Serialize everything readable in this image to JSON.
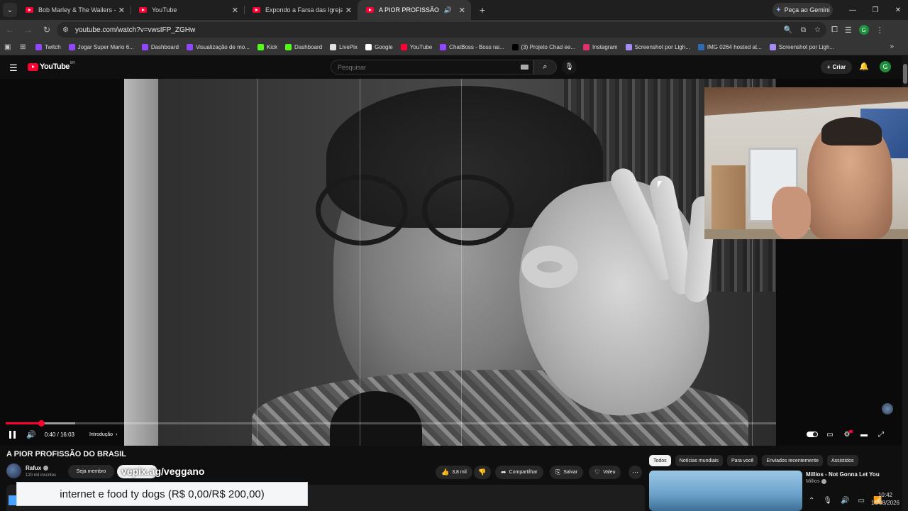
{
  "browser": {
    "tabs": [
      {
        "title": "Bob Marley & The Wailers - Exo",
        "active": false
      },
      {
        "title": "YouTube",
        "active": false
      },
      {
        "title": "Expondo a Farsa das Igrejas Ev",
        "active": false
      },
      {
        "title": "A PIOR PROFISSÃO DO BRA",
        "active": true
      }
    ],
    "gemini_label": "Peça ao Gemini",
    "url": "youtube.com/watch?v=vwsIFP_ZGHw",
    "profile_initial": "G",
    "bookmarks": [
      {
        "label": "Twitch",
        "color": "#9146ff"
      },
      {
        "label": "Jogar Super Mario 6...",
        "color": "#9146ff"
      },
      {
        "label": "Dashboard",
        "color": "#9146ff"
      },
      {
        "label": "Visualização de mo...",
        "color": "#9146ff"
      },
      {
        "label": "Kick",
        "color": "#53fc18"
      },
      {
        "label": "Dashboard",
        "color": "#53fc18"
      },
      {
        "label": "LivePix",
        "color": "#e0e0e0"
      },
      {
        "label": "Google",
        "color": "#ffffff"
      },
      {
        "label": "YouTube",
        "color": "#ff0033"
      },
      {
        "label": "ChatBoss - Boss rai...",
        "color": "#9146ff"
      },
      {
        "label": "(3) Projeto Chad ee...",
        "color": "#000000"
      },
      {
        "label": "Instagram",
        "color": "#e1306c"
      },
      {
        "label": "Screenshot por Ligh...",
        "color": "#a78bfa"
      },
      {
        "label": "IMG 0264 hosted at...",
        "color": "#2b6cb0"
      },
      {
        "label": "Screenshot por Ligh...",
        "color": "#a78bfa"
      }
    ]
  },
  "youtube": {
    "logo_text": "YouTube",
    "logo_country": "BR",
    "search_placeholder": "Pesquisar",
    "create_label": "Criar",
    "avatar_initial": "G"
  },
  "player": {
    "current_time": "0:40",
    "duration": "16:03",
    "time_display": "0:40 / 16:03",
    "progress_fraction": 0.0457,
    "chapter_label": "Introdução"
  },
  "video": {
    "title": "A PIOR PROFISSÃO DO BRASIL",
    "channel_name": "Rafux",
    "subscribers": "120 mil inscritos",
    "member_label": "Seja membro",
    "overlay_text": "vepix.ag/veggano",
    "likes": "3,8 mil",
    "share_label": "Compartilhar",
    "save_label": "Salvar",
    "thanks_label": "Valeu"
  },
  "sidebar": {
    "chips": [
      {
        "label": "Todos",
        "active": true
      },
      {
        "label": "Notícias mundiais",
        "active": false
      },
      {
        "label": "Para você",
        "active": false
      },
      {
        "label": "Enviados recentemente",
        "active": false
      },
      {
        "label": "Assistidos",
        "active": false
      }
    ],
    "recommendation": {
      "title": "Millios - Not Gonna Let You",
      "channel": "Millios"
    }
  },
  "donation_overlay": "internet e food ty dogs (R$ 0,00/R$ 200,00)",
  "system": {
    "time": "10:42",
    "date": "16/08/2026"
  },
  "colors": {
    "youtube_red": "#ff0033",
    "background": "#0f0f0f",
    "chip_bg": "#272727"
  }
}
